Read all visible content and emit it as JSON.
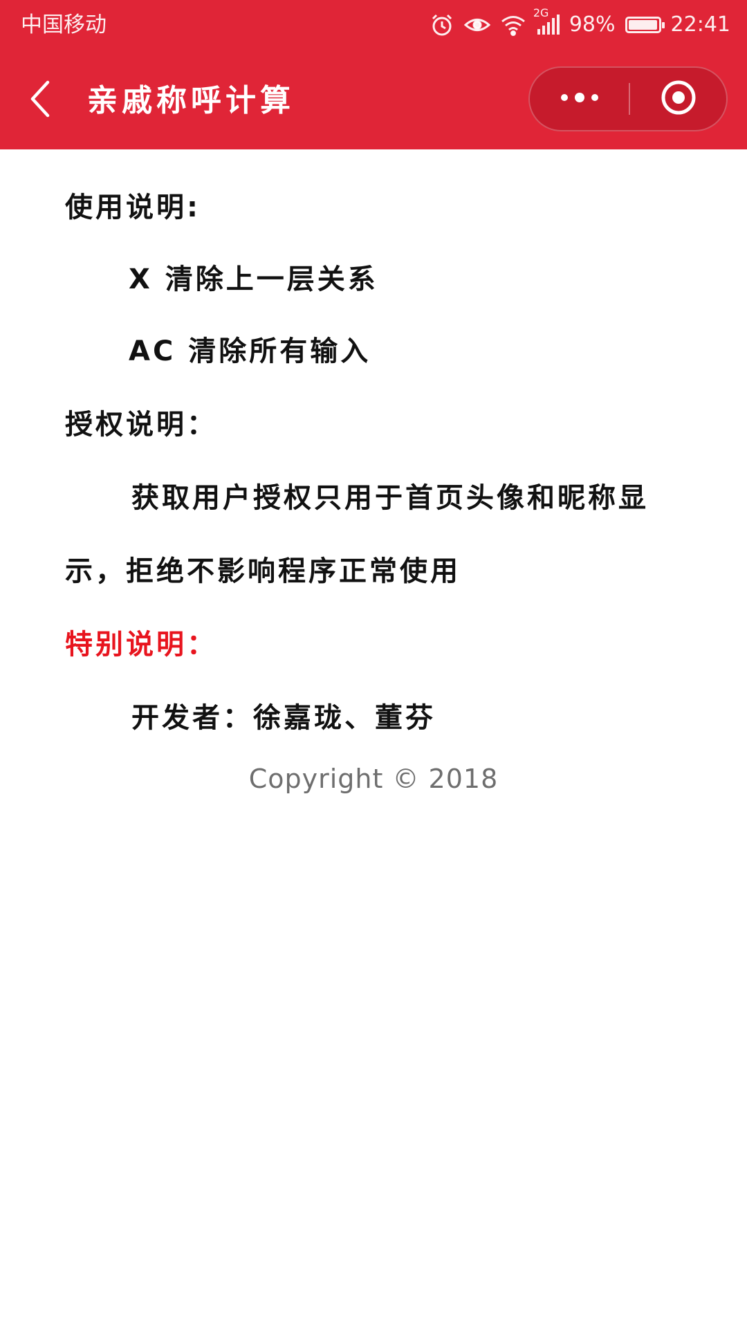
{
  "status_bar": {
    "carrier": "中国移动",
    "network": "2G",
    "battery_percent": "98%",
    "battery_level": 0.98,
    "time": "22:41",
    "icons": [
      "alarm-icon",
      "eye-icon",
      "wifi-icon",
      "signal-icon",
      "battery-icon"
    ]
  },
  "nav": {
    "title": "亲戚称呼计算",
    "back_icon": "chevron-left-icon",
    "more_icon": "more-dots-icon",
    "close_icon": "target-close-icon"
  },
  "content": {
    "usage_heading": "使用说明:",
    "usage_x": "X 清除上一层关系",
    "usage_ac": "AC 清除所有输入",
    "auth_heading": "授权说明：",
    "auth_line1": "获取用户授权只用于首页头像和昵称显",
    "auth_line2": "示，拒绝不影响程序正常使用",
    "special_heading": "特别说明：",
    "developers": "开发者：徐嘉珑、董芬",
    "copyright": "Copyright © 2018"
  },
  "colors": {
    "header_bg": "#e02537",
    "special_heading": "#e8141e",
    "copyright": "#6e6e6e"
  }
}
